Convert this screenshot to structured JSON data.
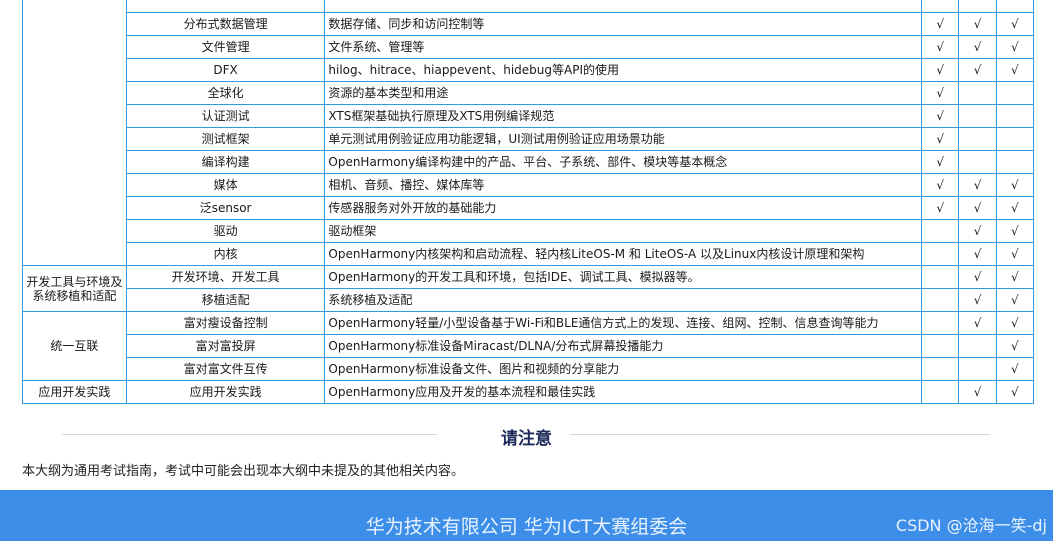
{
  "table": {
    "rows": [
      {
        "category": "",
        "item": "",
        "desc": "",
        "checks": [
          "",
          "",
          ""
        ]
      },
      {
        "category": "",
        "item": "分布式数据管理",
        "desc": "数据存储、同步和访问控制等",
        "checks": [
          "√",
          "√",
          "√"
        ]
      },
      {
        "category": "",
        "item": "文件管理",
        "desc": "文件系统、管理等",
        "checks": [
          "√",
          "√",
          "√"
        ]
      },
      {
        "category": "",
        "item": "DFX",
        "desc": "hilog、hitrace、hiappevent、hidebug等API的使用",
        "checks": [
          "√",
          "√",
          "√"
        ]
      },
      {
        "category": "",
        "item": "全球化",
        "desc": "资源的基本类型和用途",
        "checks": [
          "√",
          "",
          ""
        ]
      },
      {
        "category": "",
        "item": "认证测试",
        "desc": "XTS框架基础执行原理及XTS用例编译规范",
        "checks": [
          "√",
          "",
          ""
        ]
      },
      {
        "category": "",
        "item": "测试框架",
        "desc": "单元测试用例验证应用功能逻辑，UI测试用例验证应用场景功能",
        "checks": [
          "√",
          "",
          ""
        ]
      },
      {
        "category": "",
        "item": "编译构建",
        "desc": "OpenHarmony编译构建中的产品、平台、子系统、部件、模块等基本概念",
        "checks": [
          "√",
          "",
          ""
        ]
      },
      {
        "category": "",
        "item": "媒体",
        "desc": "相机、音频、播控、媒体库等",
        "checks": [
          "√",
          "√",
          "√"
        ]
      },
      {
        "category": "",
        "item": "泛sensor",
        "desc": "传感器服务对外开放的基础能力",
        "checks": [
          "√",
          "√",
          "√"
        ]
      },
      {
        "category": "",
        "item": "驱动",
        "desc": "驱动框架",
        "checks": [
          "",
          "√",
          "√"
        ]
      },
      {
        "category": "",
        "item": "内核",
        "desc": "OpenHarmony内核架构和启动流程、轻内核LiteOS-M 和 LiteOS-A 以及Linux内核设计原理和架构",
        "checks": [
          "",
          "√",
          "√"
        ]
      },
      {
        "category": "开发工具与环境及系统移植和适配",
        "item": "开发环境、开发工具",
        "desc": "OpenHarmony的开发工具和环境，包括IDE、调试工具、模拟器等。",
        "checks": [
          "",
          "√",
          "√"
        ]
      },
      {
        "category": "",
        "item": "移植适配",
        "desc": "系统移植及适配",
        "checks": [
          "",
          "√",
          "√"
        ]
      },
      {
        "category": "统一互联",
        "item": "富对瘦设备控制",
        "desc": "OpenHarmony轻量/小型设备基于Wi-Fi和BLE通信方式上的发现、连接、组网、控制、信息查询等能力",
        "checks": [
          "",
          "√",
          "√"
        ]
      },
      {
        "category": "",
        "item": "富对富投屏",
        "desc": "OpenHarmony标准设备Miracast/DLNA/分布式屏幕投播能力",
        "checks": [
          "",
          "",
          "√"
        ]
      },
      {
        "category": "",
        "item": "富对富文件互传",
        "desc": "OpenHarmony标准设备文件、图片和视频的分享能力",
        "checks": [
          "",
          "",
          "√"
        ]
      },
      {
        "category": "应用开发实践",
        "item": "应用开发实践",
        "desc": "OpenHarmony应用及开发的基本流程和最佳实践",
        "checks": [
          "",
          "√",
          "√"
        ]
      }
    ]
  },
  "notice": {
    "title": "请注意",
    "text": "本大纲为通用考试指南，考试中可能会出现本大纲中未提及的其他相关内容。"
  },
  "footer": {
    "org": "华为技术有限公司 华为ICT大赛组委会",
    "watermark": "CSDN @沧海一笑-dj"
  },
  "colors": {
    "border": "#2f9be0",
    "footer_bg": "#3c8ee9",
    "title": "#1d2a5a"
  }
}
